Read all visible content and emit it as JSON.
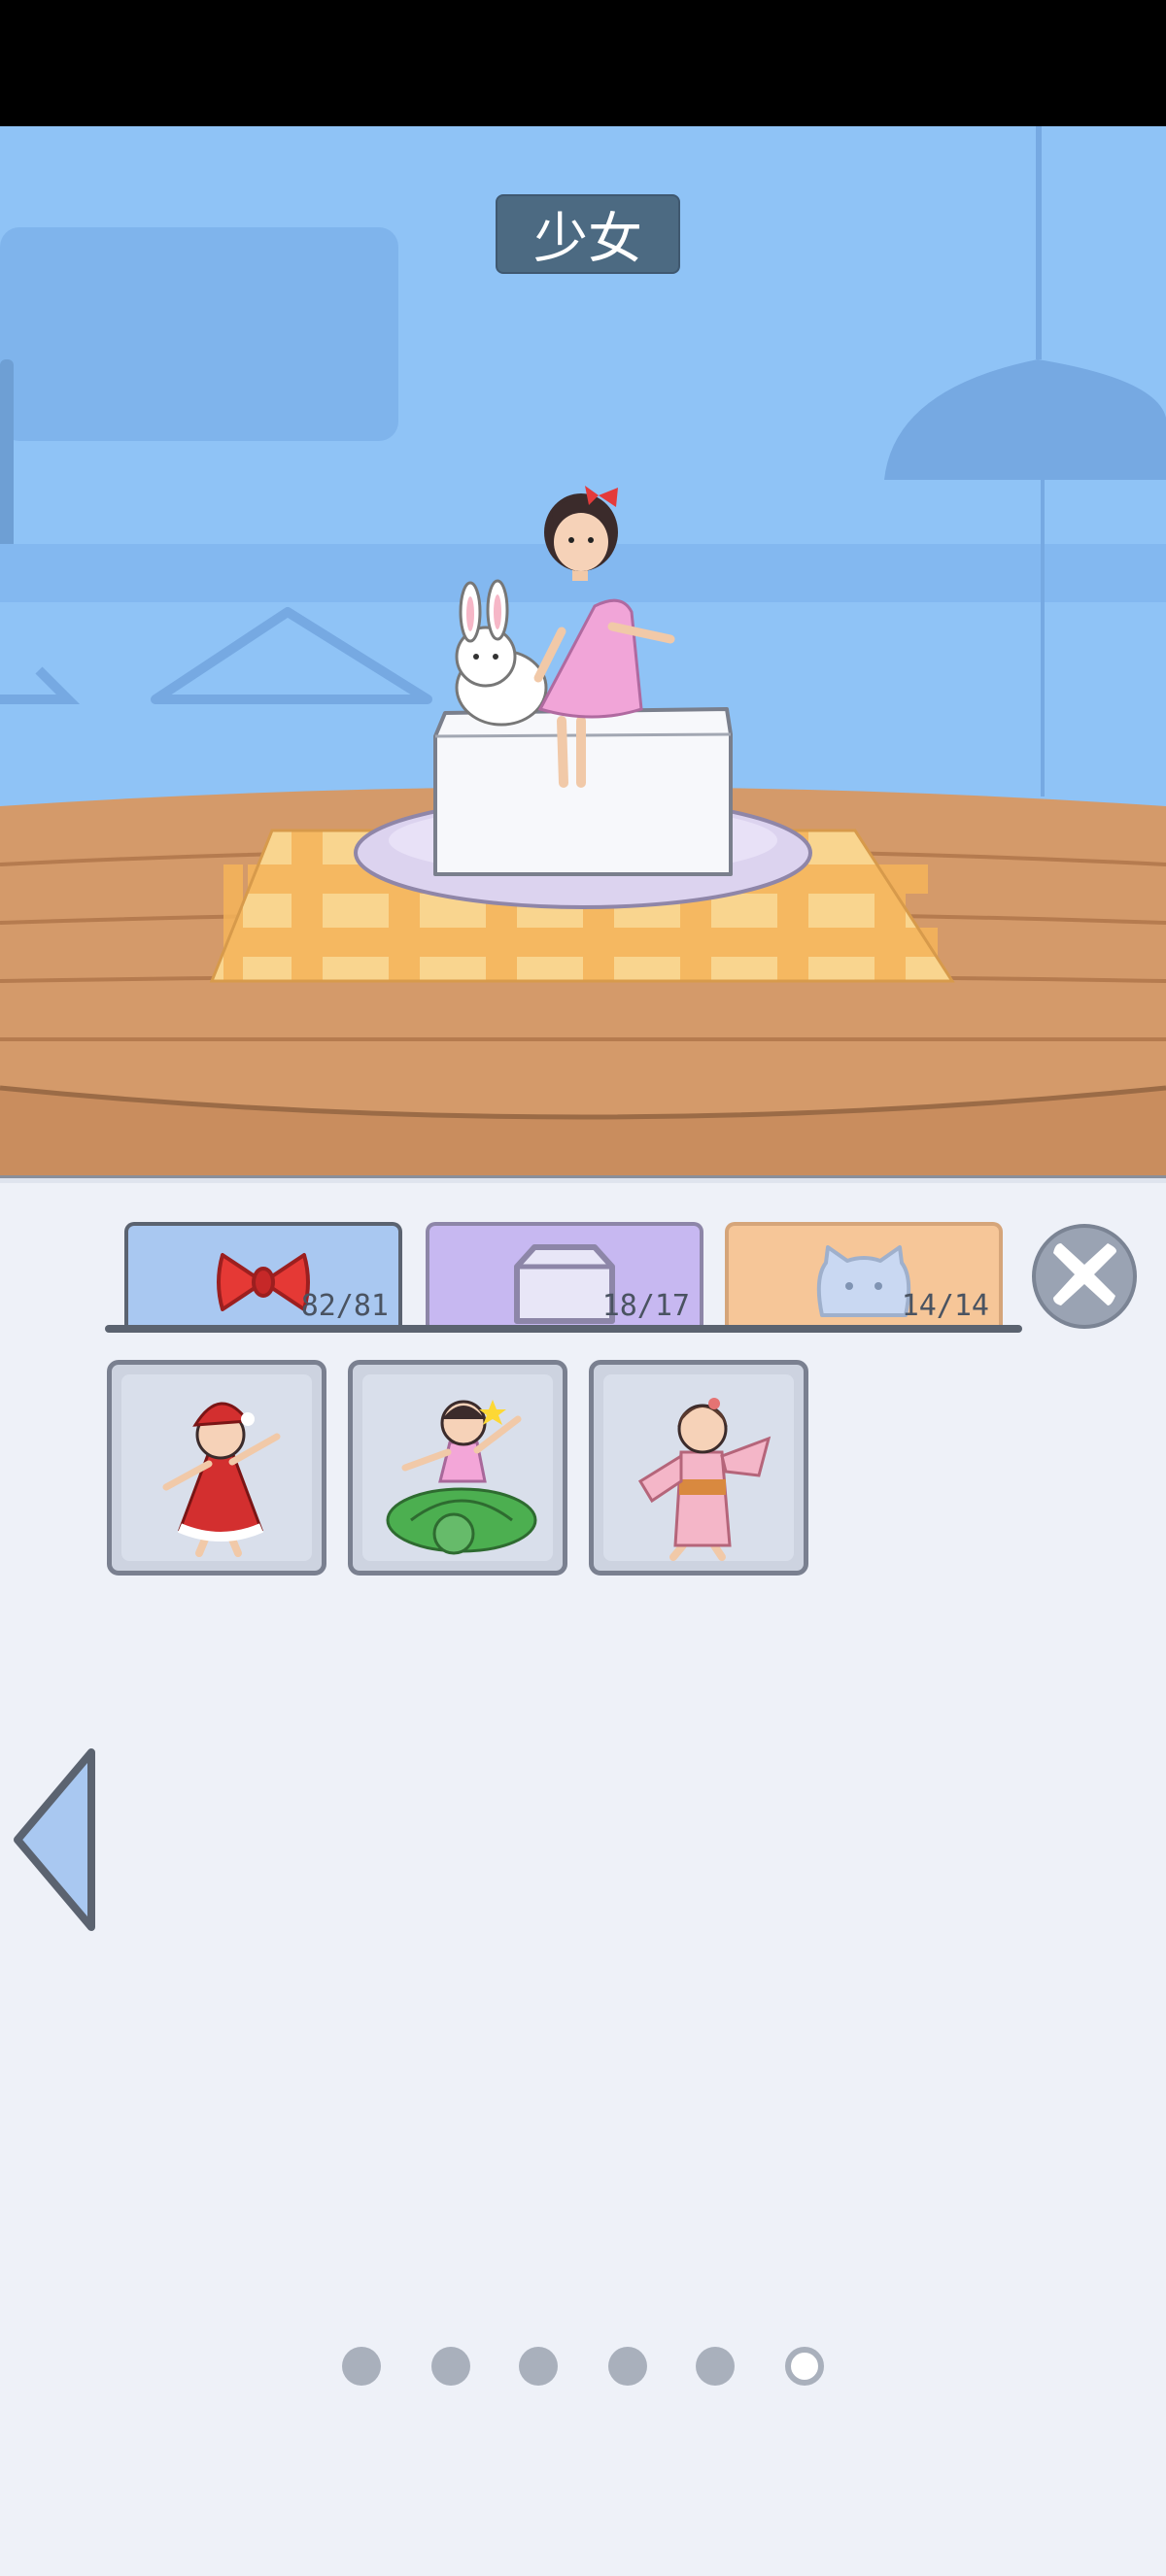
{
  "scene": {
    "title": "少女",
    "character": "girl-in-pink-dress",
    "companion": "rabbit"
  },
  "tabs": [
    {
      "name": "accessories",
      "icon": "bow-icon",
      "count": "82/81"
    },
    {
      "name": "containers",
      "icon": "box-icon",
      "count": "18/17"
    },
    {
      "name": "pets",
      "icon": "cat-icon",
      "count": "14/14"
    }
  ],
  "items": [
    {
      "name": "santa-outfit-girl"
    },
    {
      "name": "turtle-swim-girl"
    },
    {
      "name": "kimono-girl"
    }
  ],
  "pagination": {
    "pages": 6,
    "current": 6
  },
  "colors": {
    "sky": "#8fc3f6",
    "table": "#d49a6a",
    "cloth": "#f7c46a",
    "panel": "#eef1f8"
  }
}
